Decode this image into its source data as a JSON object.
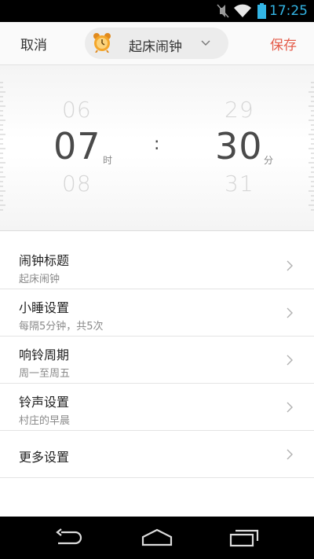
{
  "status_bar": {
    "time": "17:25",
    "icons": [
      "mute-icon",
      "wifi-icon",
      "battery-icon"
    ]
  },
  "header": {
    "cancel_label": "取消",
    "save_label": "保存",
    "title": "起床闹钟",
    "title_icon": "alarm-clock-icon",
    "dropdown_icon": "chevron-down-icon",
    "save_color": "#e45c4a"
  },
  "picker": {
    "hour_prev": "06",
    "hour": "07",
    "hour_next": "08",
    "hour_unit": "时",
    "separator": ":",
    "minute_prev": "29",
    "minute": "30",
    "minute_next": "31",
    "minute_unit": "分"
  },
  "settings": {
    "items": [
      {
        "title": "闹钟标题",
        "subtitle": "起床闹钟"
      },
      {
        "title": "小睡设置",
        "subtitle": "每隔5分钟，共5次"
      },
      {
        "title": "响铃周期",
        "subtitle": "周一至周五"
      },
      {
        "title": "铃声设置",
        "subtitle": "村庄的早晨"
      },
      {
        "title": "更多设置"
      }
    ]
  },
  "nav_bar": {
    "buttons": [
      "back-icon",
      "home-icon",
      "recent-apps-icon"
    ]
  }
}
